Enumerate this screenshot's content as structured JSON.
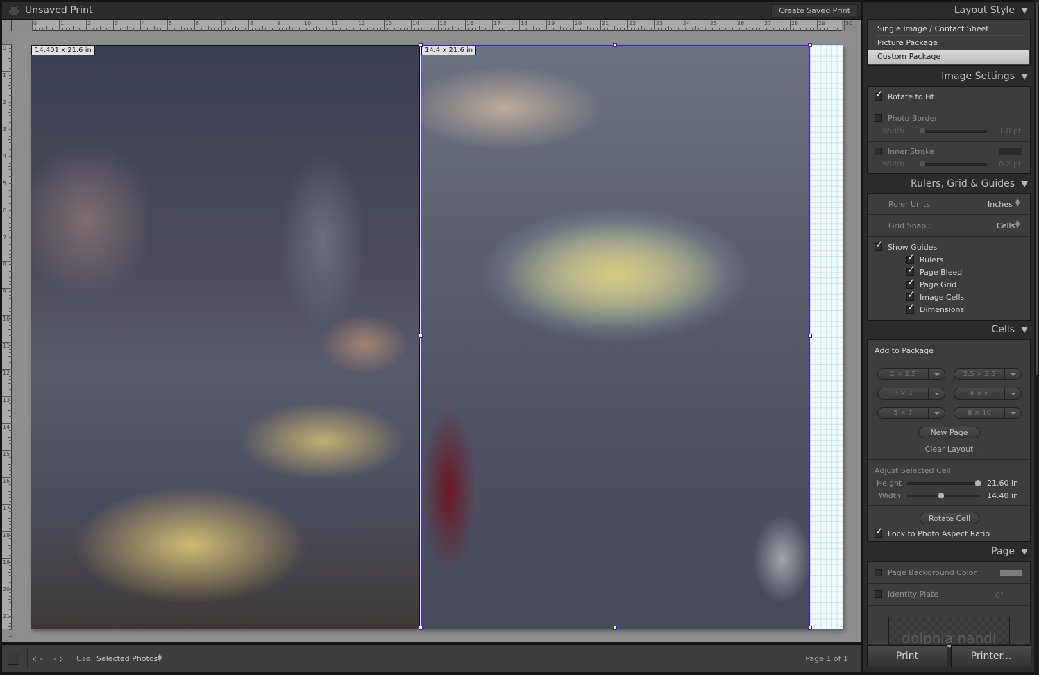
{
  "window": {
    "title": "Unsaved Print",
    "create_saved_print_label": "Create Saved Print"
  },
  "rulers": {
    "horizontal_labels": [
      "0",
      "1",
      "2",
      "3",
      "4",
      "5",
      "6",
      "7",
      "8",
      "9",
      "10",
      "11",
      "12",
      "13",
      "14",
      "15",
      "16",
      "17",
      "18",
      "19",
      "20",
      "21",
      "22",
      "23",
      "24",
      "25",
      "26",
      "27",
      "28",
      "29",
      "30"
    ],
    "vertical_labels": [
      "0",
      "1",
      "2",
      "3",
      "4",
      "5",
      "6",
      "7",
      "8",
      "9",
      "10",
      "11",
      "12",
      "13",
      "14",
      "15",
      "16",
      "17",
      "18",
      "19",
      "20",
      "21"
    ],
    "cursor_marker_h": 17.5,
    "cursor_marker_v": 15.3,
    "accent_color": "#e5a800"
  },
  "canvas": {
    "cells": [
      {
        "dimensions": "14.401 x 21.6 in",
        "selected": false
      },
      {
        "dimensions": "14.4 x 21.6 in",
        "selected": true
      }
    ],
    "selection_color": "#3d1ad6"
  },
  "toolbar": {
    "use_label": "Use:",
    "use_value": "Selected Photos",
    "page_count": "Page 1 of 1"
  },
  "panel": {
    "layout_style": {
      "header": "Layout Style",
      "items": [
        {
          "label": "Single Image / Contact Sheet",
          "selected": false
        },
        {
          "label": "Picture Package",
          "selected": false
        },
        {
          "label": "Custom Package",
          "selected": true
        }
      ]
    },
    "image_settings": {
      "header": "Image Settings",
      "rotate_to_fit": {
        "label": "Rotate to Fit",
        "checked": true
      },
      "photo_border": {
        "label": "Photo Border",
        "checked": false,
        "width_label": "Width",
        "width_value": "1.0 pt"
      },
      "inner_stroke": {
        "label": "Inner Stroke",
        "checked": false,
        "width_label": "Width",
        "width_value": "0.2 pt"
      }
    },
    "rulers_grid_guides": {
      "header": "Rulers, Grid & Guides",
      "ruler_units_label": "Ruler Units :",
      "ruler_units_value": "Inches",
      "grid_snap_label": "Grid Snap :",
      "grid_snap_value": "Cells",
      "show_guides": {
        "label": "Show Guides",
        "checked": true
      },
      "guides": [
        {
          "label": "Rulers",
          "checked": true
        },
        {
          "label": "Page Bleed",
          "checked": true
        },
        {
          "label": "Page Grid",
          "checked": true
        },
        {
          "label": "Image Cells",
          "checked": true
        },
        {
          "label": "Dimensions",
          "checked": true
        }
      ]
    },
    "cells": {
      "header": "Cells",
      "add_to_package_label": "Add to Package",
      "sizes": [
        "2 × 2.5",
        "2.5 × 3.5",
        "3 × 7",
        "4 × 6",
        "5 × 7",
        "8 × 10"
      ],
      "new_page_label": "New Page",
      "clear_layout_label": "Clear Layout",
      "adjust_label": "Adjust Selected Cell",
      "height_label": "Height",
      "height_value": "21.60 in",
      "height_fraction": 0.97,
      "width_label": "Width",
      "width_value": "14.40 in",
      "width_fraction": 0.47,
      "rotate_cell_label": "Rotate Cell",
      "lock_aspect": {
        "label": "Lock to Photo Aspect Ratio",
        "checked": true
      }
    },
    "page": {
      "header": "Page",
      "page_bg_color": {
        "label": "Page Background Color",
        "checked": false
      },
      "identity_plate": {
        "label": "Identity Plate",
        "checked": false,
        "angle": "0°",
        "text": "dolphia nandi"
      }
    },
    "print_label": "Print",
    "printer_label": "Printer..."
  }
}
